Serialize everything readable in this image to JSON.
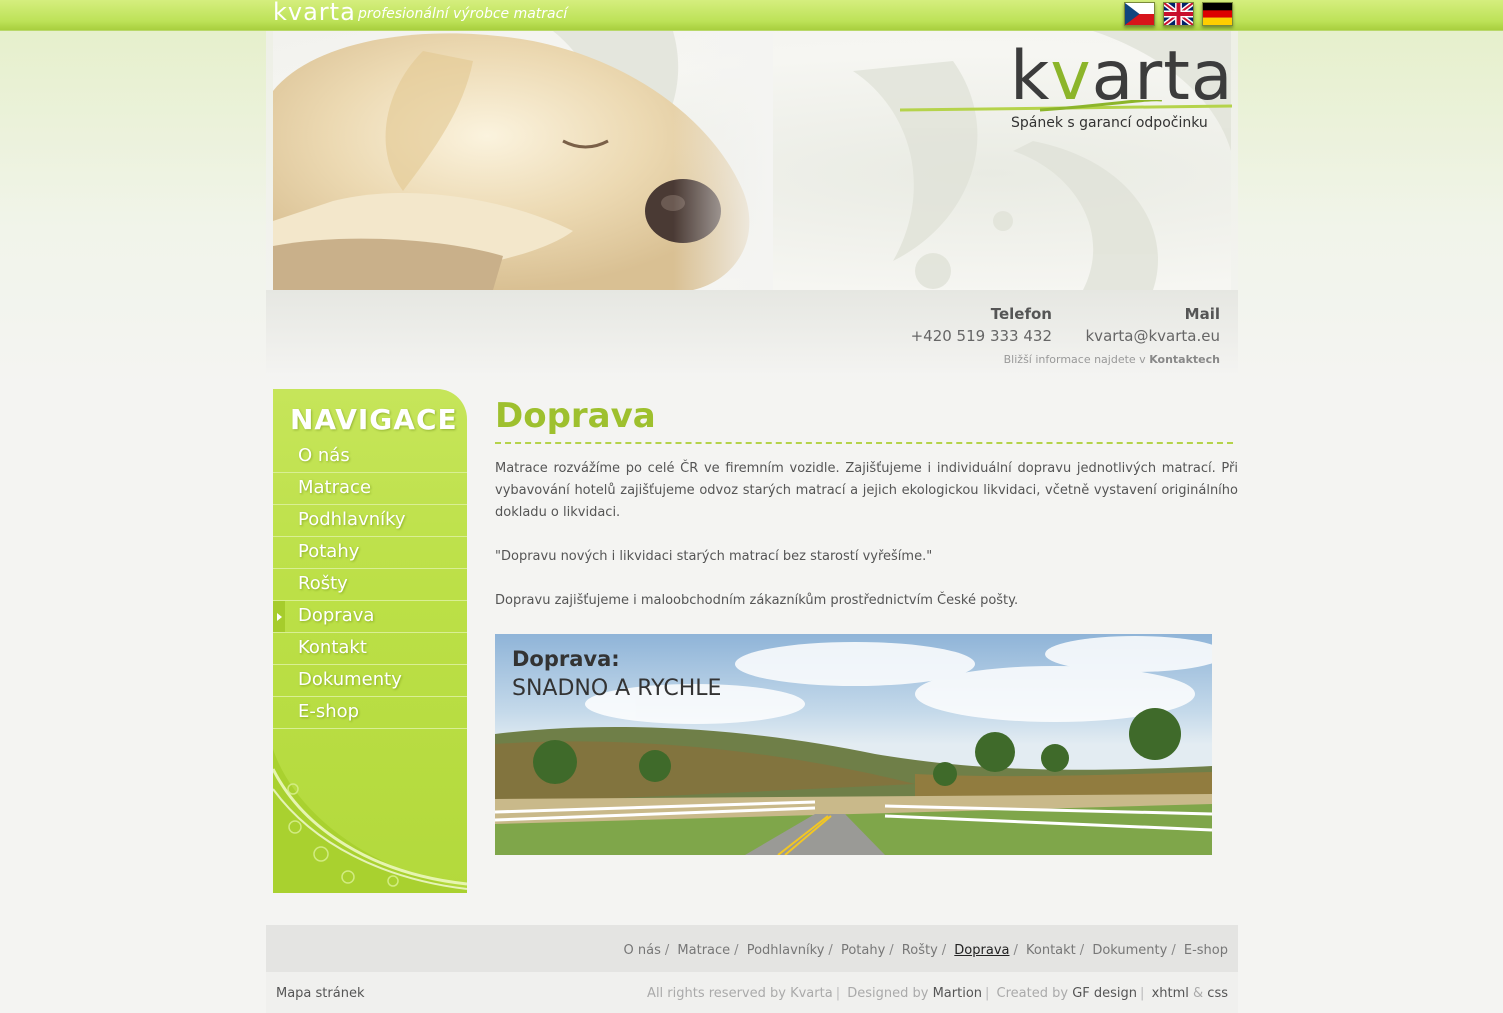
{
  "top": {
    "logo": "kvarta",
    "slogan": "profesionální výrobce matrací",
    "flags": [
      "czech-flag",
      "uk-flag",
      "german-flag"
    ]
  },
  "header": {
    "logo_text_k": "k",
    "logo_text_v": "v",
    "logo_text_rest": "arta",
    "tagline": "Spánek s garancí odpočinku"
  },
  "contact": {
    "phone_label": "Telefon",
    "phone": "+420 519 333 432",
    "mail_label": "Mail",
    "mail": "kvarta@kvarta.eu",
    "info_prefix": "Bližší informace najdete v",
    "info_link": "Kontaktech"
  },
  "nav": {
    "title": "NAVIGACE",
    "items": [
      {
        "label": "O nás"
      },
      {
        "label": "Matrace"
      },
      {
        "label": "Podhlavníky"
      },
      {
        "label": "Potahy"
      },
      {
        "label": "Rošty"
      },
      {
        "label": "Doprava"
      },
      {
        "label": "Kontakt"
      },
      {
        "label": "Dokumenty"
      },
      {
        "label": "E-shop"
      }
    ],
    "active_index": 5
  },
  "content": {
    "title": "Doprava",
    "paragraphs": [
      "Matrace rozvážíme po celé ČR ve firemním vozidle. Zajišťujeme i individuální dopravu jednotlivých matrací. Při vybavování hotelů zajišťujeme odvoz starých matrací a jejich ekologickou likvidaci, včetně vystavení originálního dokladu o likvidaci.",
      "\"Dopravu nových i likvidaci starých matrací bez starostí vyřešíme.\"",
      "Dopravu zajišťujeme i maloobchodním zákazníkům prostřednictvím České pošty."
    ],
    "photo_title": "Doprava:",
    "photo_subtitle": "SNADNO A RYCHLE"
  },
  "footer": {
    "links": [
      "O nás",
      "Matrace",
      "Podhlavníky",
      "Potahy",
      "Rošty",
      "Doprava",
      "Kontakt",
      "Dokumenty",
      "E-shop"
    ],
    "separator": "/",
    "sitemap": "Mapa stránek",
    "rights": "All rights reserved by",
    "rights_name": "Kvarta",
    "designed_by": "Designed by",
    "designer": "Martion",
    "created_by": "Created by",
    "creator": "GF design",
    "xhtml": "xhtml",
    "amp": "&",
    "css": "css"
  },
  "colors": {
    "accent_green": "#9ec02e",
    "nav_green": "#bce047",
    "topbar_green": "#bde258"
  }
}
